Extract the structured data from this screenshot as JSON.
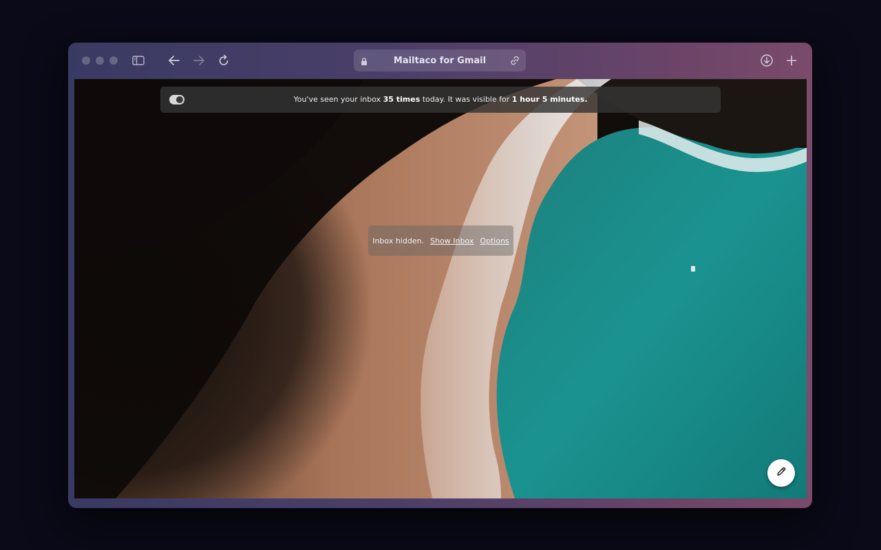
{
  "browser": {
    "address_title": "Mailtaco for Gmail",
    "icons": [
      "sidebar-icon",
      "back-icon",
      "forward-icon",
      "reload-icon",
      "lock-icon",
      "link-icon",
      "download-icon",
      "new-tab-icon"
    ]
  },
  "stats_bar": {
    "prefix": "You've seen your inbox ",
    "count": "35 times",
    "middle": " today. It was visible for ",
    "duration": "1 hour 5 minutes.",
    "toggle_on": true
  },
  "inbox_notice": {
    "status": "Inbox hidden.",
    "show_link": "Show Inbox",
    "options_link": "Options"
  },
  "compose": {
    "icon": "pencil-icon"
  },
  "colors": {
    "window_gradient_start": "#393a63",
    "window_gradient_end": "#7a4a6a",
    "ocean": "#1a8a88",
    "sand": "#a9775a"
  }
}
